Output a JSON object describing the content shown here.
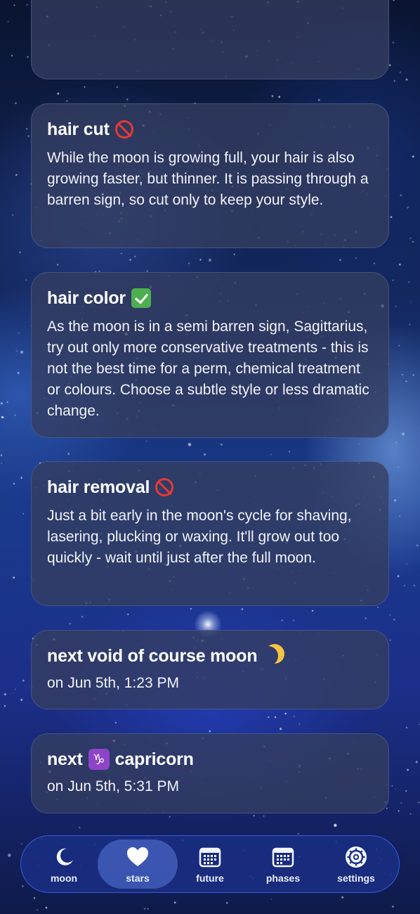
{
  "cards": [
    {
      "title": "hair cut",
      "icon": "no-entry-icon",
      "body": "While the moon is growing full, your hair is also growing faster, but thinner. It is passing through a barren sign, so cut only to keep your style."
    },
    {
      "title": "hair color",
      "icon": "check-mark-icon",
      "body": "As the moon is in a semi barren sign, Sagittarius, try out only more conservative treatments - this is not the best time for a perm, chemical treatment or colours. Choose a subtle style or less dramatic change."
    },
    {
      "title": "hair removal",
      "icon": "no-entry-icon",
      "body": "Just a bit early in the moon's cycle for shaving, lasering, plucking or waxing. It'll grow out too quickly - wait until just after the full moon."
    },
    {
      "title": "next void of course moon",
      "icon": "crescent-moon-icon",
      "subtitle": "on Jun 5th, 1:23 PM"
    },
    {
      "title_prefix": "next",
      "title_suffix": "capricorn",
      "icon": "capricorn-icon",
      "icon_glyph": "♑",
      "subtitle": "on Jun 5th, 5:31 PM"
    }
  ],
  "tabbar": {
    "items": [
      {
        "label": "moon",
        "icon": "moon-icon",
        "active": false
      },
      {
        "label": "stars",
        "icon": "heart-icon",
        "active": true
      },
      {
        "label": "future",
        "icon": "calendar-icon",
        "active": false
      },
      {
        "label": "phases",
        "icon": "calendar-grid-icon",
        "active": false
      },
      {
        "label": "settings",
        "icon": "gear-icon",
        "active": false
      }
    ]
  },
  "colors": {
    "accent_border": "#3c6eff",
    "tabbar_bg": "#192d82",
    "card_bg": "#343e60",
    "no_entry": "#e53935",
    "check": "#4caf50",
    "capricorn_badge": "#8e44c9",
    "moon_emoji": "#f5c542"
  }
}
